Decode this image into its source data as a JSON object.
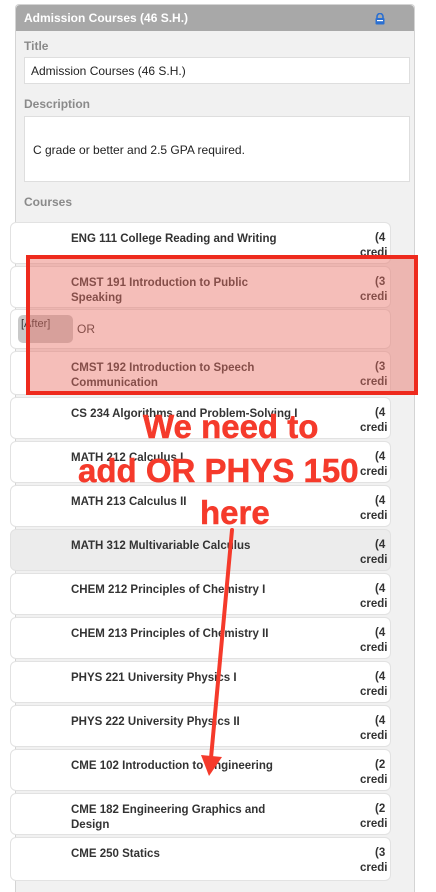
{
  "panel": {
    "header_title": "Admission Courses (46 S.H.)",
    "lock_icon": "lock-icon",
    "title_label": "Title",
    "title_value": "Admission Courses (46 S.H.)",
    "description_label": "Description",
    "description_value": "C grade or better and 2.5 GPA required.",
    "courses_label": "Courses"
  },
  "courses": [
    {
      "name": "ENG 111 College Reading and Writing",
      "credits": "(4",
      "credit_word": "credi"
    },
    {
      "name": "CMST 191 Introduction to Public Speaking",
      "credits": "(3",
      "credit_word": "credi"
    },
    {
      "name": "CMST 192 Introduction to Speech Communication",
      "credits": "(3",
      "credit_word": "credi"
    },
    {
      "name": "CS 234 Algorithms and Problem-Solving I",
      "credits": "(4",
      "credit_word": "credi"
    },
    {
      "name": "MATH 212 Calculus I",
      "credits": "(4",
      "credit_word": "credi"
    },
    {
      "name": "MATH 213 Calculus II",
      "credits": "(4",
      "credit_word": "credi"
    },
    {
      "name": "MATH 312 Multivariable Calculus",
      "credits": "(4",
      "credit_word": "credi"
    },
    {
      "name": "CHEM 212 Principles of Chemistry I",
      "credits": "(4",
      "credit_word": "credi"
    },
    {
      "name": "CHEM 213 Principles of Chemistry II",
      "credits": "(4",
      "credit_word": "credi"
    },
    {
      "name": "PHYS 221 University Physics I",
      "credits": "(4",
      "credit_word": "credi"
    },
    {
      "name": "PHYS 222 University Physics II",
      "credits": "(4",
      "credit_word": "credi"
    },
    {
      "name": "CME 102 Introduction to Engineering",
      "credits": "(2",
      "credit_word": "credi"
    },
    {
      "name": "CME 182 Engineering Graphics and Design",
      "credits": "(2",
      "credit_word": "credi"
    },
    {
      "name": "CME 250 Statics",
      "credits": "(3",
      "credit_word": "credi"
    }
  ],
  "or_row": {
    "badge": "[After]",
    "text": "OR"
  },
  "annotation": {
    "line1": "We need to",
    "line2": "add OR  PHYS 150",
    "line3": "here",
    "color": "#f53a2b"
  }
}
